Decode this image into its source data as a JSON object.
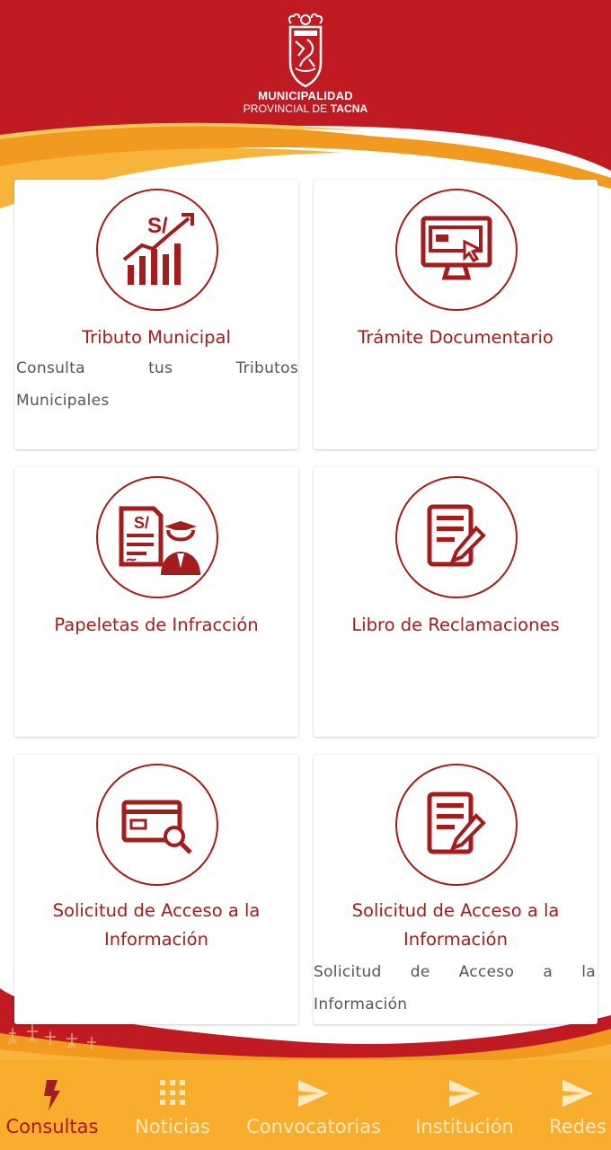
{
  "header": {
    "logo_name": "municipal-coat-of-arms",
    "logo_line1": "MUNICIPALIDAD",
    "logo_line2_prefix": "PROVINCIAL DE ",
    "logo_line2_bold": "TACNA",
    "colors": {
      "red": "#c01a22",
      "orange": "#f29a1f",
      "yellow": "#f8b43a"
    }
  },
  "cards": [
    {
      "title": "Tributo Municipal",
      "description_words": [
        "Consulta",
        "tus",
        "Tributos"
      ],
      "description_line2": "Municipales",
      "icon": "tax-growth-chart-icon"
    },
    {
      "title": "Trámite Documentario",
      "icon": "computer-monitor-icon"
    },
    {
      "title": "Papeletas de Infracción",
      "icon": "traffic-ticket-officer-icon"
    },
    {
      "title": "Libro de Reclamaciones",
      "icon": "document-edit-icon"
    },
    {
      "title": "Solicitud de Acceso a la Información",
      "icon": "card-search-icon"
    },
    {
      "title": "Solicitud de Acceso a la Información",
      "description_words": [
        "Solicitud",
        "de",
        "Acceso",
        "a",
        "la"
      ],
      "description_line2": "Información",
      "icon": "document-edit-icon"
    }
  ],
  "nav": {
    "active": "Consultas",
    "items": [
      {
        "label": "Consultas",
        "icon": "lightning-icon"
      },
      {
        "label": "Noticias",
        "icon": "grid-icon"
      },
      {
        "label": "Convocatorias",
        "icon": "send-icon"
      },
      {
        "label": "Institución",
        "icon": "send-icon"
      },
      {
        "label": "Redes",
        "icon": "send-icon"
      }
    ],
    "colors": {
      "bar": "#f8ae2c",
      "active": "#a51c1c",
      "inactive": "#fde8bf"
    }
  }
}
